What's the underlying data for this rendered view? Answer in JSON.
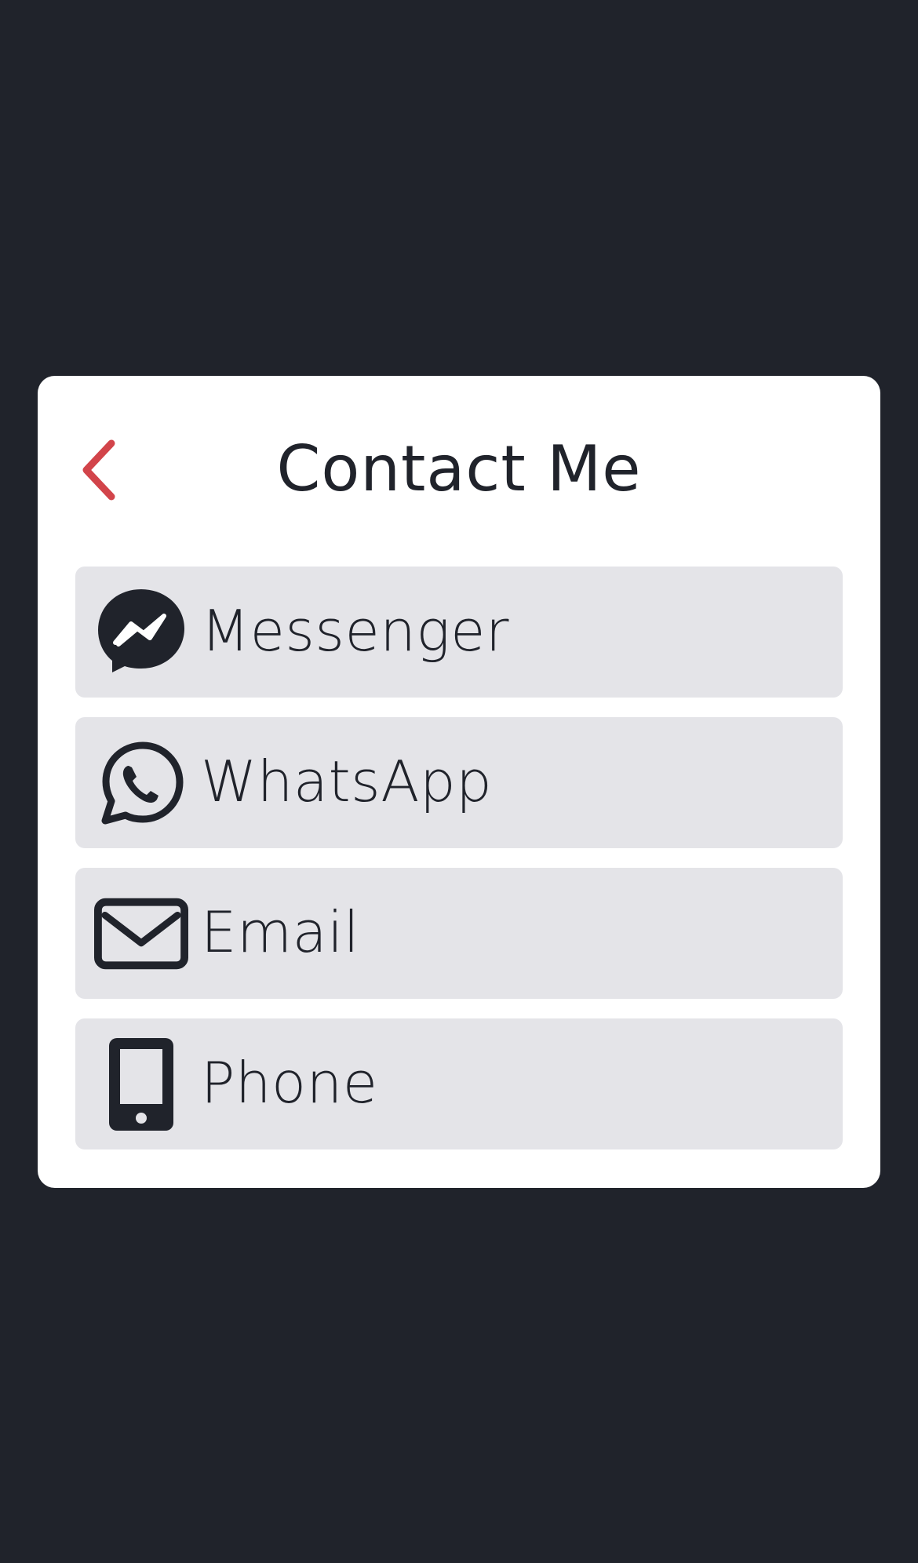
{
  "modal": {
    "title": "Contact Me",
    "back_icon": "chevron-left-icon",
    "options": [
      {
        "label": "Messenger",
        "icon": "messenger-icon"
      },
      {
        "label": "WhatsApp",
        "icon": "whatsapp-icon"
      },
      {
        "label": "Email",
        "icon": "envelope-icon"
      },
      {
        "label": "Phone",
        "icon": "mobile-phone-icon"
      }
    ]
  },
  "colors": {
    "background": "#20232b",
    "card": "#ffffff",
    "option_bg": "#e4e4e8",
    "text": "#20232b",
    "accent": "#d2444a"
  }
}
